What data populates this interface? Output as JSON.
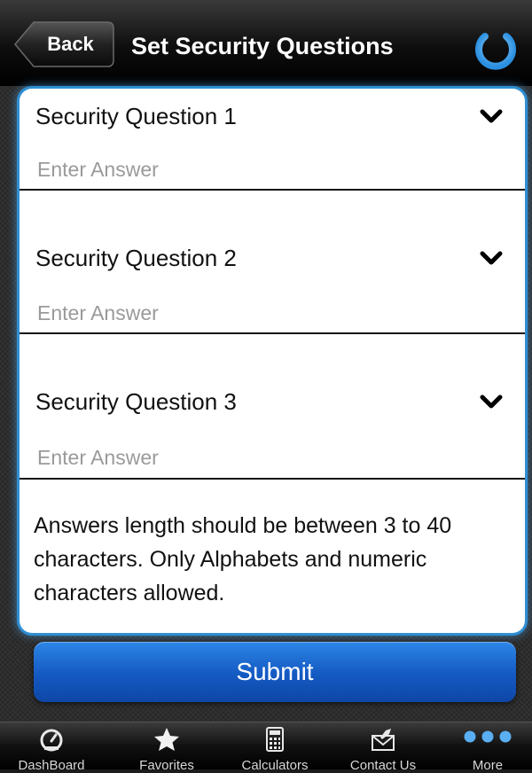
{
  "header": {
    "back_label": "Back",
    "title": "Set Security Questions",
    "power_icon": "power-icon"
  },
  "questions": [
    {
      "label": "Security Question 1",
      "answer_placeholder": "Enter Answer",
      "answer_value": ""
    },
    {
      "label": "Security Question 2",
      "answer_placeholder": "Enter Answer",
      "answer_value": ""
    },
    {
      "label": "Security Question 3",
      "answer_placeholder": "Enter Answer",
      "answer_value": ""
    }
  ],
  "note": "Answers length should be between 3 to 40 characters. Only Alphabets and numeric characters allowed.",
  "submit_label": "Submit",
  "tabs": [
    {
      "label": "DashBoard",
      "icon": "dashboard-icon"
    },
    {
      "label": "Favorites",
      "icon": "star-icon"
    },
    {
      "label": "Calculators",
      "icon": "calculator-icon"
    },
    {
      "label": "Contact Us",
      "icon": "mail-icon"
    },
    {
      "label": "More",
      "icon": "more-dots-icon"
    }
  ],
  "colors": {
    "accent": "#1a66d2",
    "card_glow": "#2f8fd4",
    "navbar": "#000000"
  }
}
